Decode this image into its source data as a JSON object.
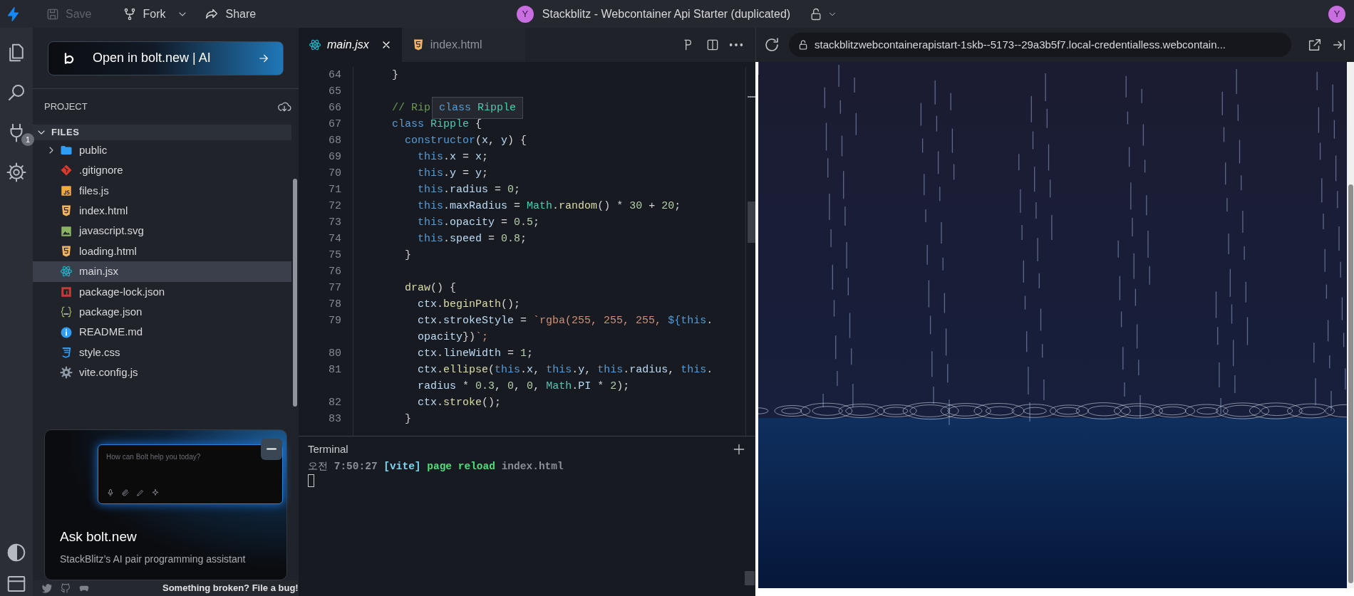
{
  "top_bar": {
    "save": {
      "label": "Save",
      "disabled": true
    },
    "fork": {
      "label": "Fork"
    },
    "share": {
      "label": "Share"
    },
    "owner_avatar": "Y",
    "project_title": "Stackblitz - Webcontainer Api Starter (duplicated)",
    "user_avatar": "Y"
  },
  "activity_bar": {
    "plugins_badge": "1"
  },
  "sidebar": {
    "bolt_button": "Open in bolt.new | AI",
    "section_title": "PROJECT",
    "files_header": {
      "label": "FILES",
      "expanded": true
    },
    "files": [
      {
        "label": "public",
        "kind": "folder",
        "expanded": false,
        "selected": false
      },
      {
        "label": ".gitignore",
        "kind": "git",
        "selected": false
      },
      {
        "label": "files.js",
        "kind": "js",
        "selected": false
      },
      {
        "label": "index.html",
        "kind": "html",
        "selected": false
      },
      {
        "label": "javascript.svg",
        "kind": "image",
        "selected": false
      },
      {
        "label": "loading.html",
        "kind": "html",
        "selected": false
      },
      {
        "label": "main.jsx",
        "kind": "react",
        "selected": true
      },
      {
        "label": "package-lock.json",
        "kind": "npm",
        "selected": false
      },
      {
        "label": "package.json",
        "kind": "json",
        "selected": false
      },
      {
        "label": "README.md",
        "kind": "info",
        "selected": false
      },
      {
        "label": "style.css",
        "kind": "css",
        "selected": false
      },
      {
        "label": "vite.config.js",
        "kind": "gear",
        "selected": false
      }
    ],
    "bolt_card": {
      "prompt_placeholder": "How can Bolt help you today?",
      "title": "Ask bolt.new",
      "subtitle": "StackBlitz’s AI pair programming assistant"
    },
    "footer": {
      "bug_link": "Something broken? File a bug!"
    }
  },
  "editor": {
    "tabs": [
      {
        "label": "main.jsx",
        "kind": "react",
        "selected": true
      },
      {
        "label": "index.html",
        "kind": "html",
        "selected": false
      }
    ],
    "lines": [
      {
        "number": "64",
        "text": "}"
      },
      {
        "number": "65"
      },
      {
        "number": "66",
        "text": "// Rip",
        "tooltip": {
          "keyword": "class",
          "name": "Ripple"
        }
      },
      {
        "number": "67",
        "text": "class Ripple {"
      },
      {
        "number": "68",
        "text": "  constructor(x, y) {"
      },
      {
        "number": "69",
        "text": "    this.x = x;"
      },
      {
        "number": "70",
        "text": "    this.y = y;"
      },
      {
        "number": "71",
        "text": "    this.radius = 0;"
      },
      {
        "number": "72",
        "text": "    this.maxRadius = Math.random() * 30 + 20;"
      },
      {
        "number": "73",
        "text": "    this.opacity = 0.5;"
      },
      {
        "number": "74",
        "text": "    this.speed = 0.8;"
      },
      {
        "number": "75",
        "text": "  }"
      },
      {
        "number": "76"
      },
      {
        "number": "77",
        "text": "  draw() {"
      },
      {
        "number": "78",
        "text": "    ctx.beginPath();"
      },
      {
        "number": "79",
        "text": "    ctx.strokeStyle = `rgba(255, 255, 255, ${this.",
        "continuation": "    opacity})`;"
      },
      {
        "number": "80",
        "text": "    ctx.lineWidth = 1;"
      },
      {
        "number": "81",
        "text": "    ctx.ellipse(this.x, this.y, this.radius, this.",
        "continuation": "    radius * 0.3, 0, 0, Math.PI * 2);"
      },
      {
        "number": "82",
        "text": "    ctx.stroke();"
      },
      {
        "number": "83",
        "text": "  }"
      }
    ]
  },
  "terminal": {
    "title": "Terminal",
    "lines": [
      {
        "meridiem": "오전",
        "time": "7:50:27",
        "tag": "[vite]",
        "message": "page reload",
        "file": "index.html"
      }
    ]
  },
  "preview": {
    "url": "stackblitzwebcontainerapistart-1skb--5173--29a3b5f7.local-credentialless.webcontain..."
  }
}
